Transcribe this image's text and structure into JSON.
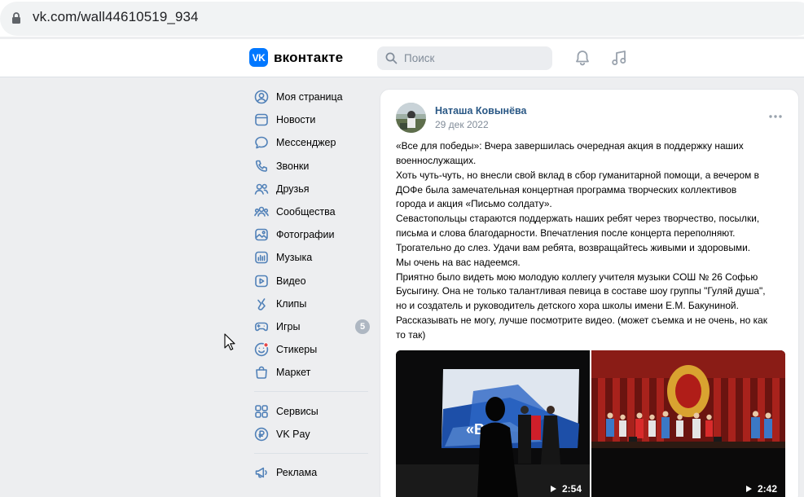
{
  "browser": {
    "url": "vk.com/wall44610519_934"
  },
  "header": {
    "logo_mark": "VK",
    "logo_text": "вконтакте",
    "search_placeholder": "Поиск"
  },
  "sidebar": {
    "group1": [
      {
        "label": "Моя страница",
        "icon": "user-icon"
      },
      {
        "label": "Новости",
        "icon": "news-icon"
      },
      {
        "label": "Мессенджер",
        "icon": "chat-icon"
      },
      {
        "label": "Звонки",
        "icon": "phone-icon"
      },
      {
        "label": "Друзья",
        "icon": "friends-icon"
      },
      {
        "label": "Сообщества",
        "icon": "communities-icon"
      },
      {
        "label": "Фотографии",
        "icon": "photos-icon"
      },
      {
        "label": "Музыка",
        "icon": "music-icon"
      },
      {
        "label": "Видео",
        "icon": "video-icon"
      },
      {
        "label": "Клипы",
        "icon": "clips-icon"
      },
      {
        "label": "Игры",
        "icon": "games-icon",
        "badge": "5"
      },
      {
        "label": "Стикеры",
        "icon": "stickers-icon"
      },
      {
        "label": "Маркет",
        "icon": "market-icon"
      }
    ],
    "group2": [
      {
        "label": "Сервисы",
        "icon": "services-icon"
      },
      {
        "label": "VK Pay",
        "icon": "vkpay-icon"
      }
    ],
    "group3": [
      {
        "label": "Реклама",
        "icon": "ads-icon"
      }
    ]
  },
  "post": {
    "author": "Наташа Ковынёва",
    "date": "29 дек 2022",
    "lines": [
      "«Все для победы»: Вчера завершилась очередная акция в поддержку наших",
      "военнослужащих.",
      "Хоть чуть-чуть, но внесли свой вклад в сбор гуманитарной помощи, а вечером в",
      "ДОФе была замечательная концертная программа творческих коллективов",
      "города и акция «Письмо солдату».",
      "Севастопольцы стараются поддержать наших ребят через творчество, посылки,",
      "письма и слова благодарности. Впечатления после концерта переполняют.",
      "Трогательно до слез. Удачи вам ребята, возвращайтесь живыми и здоровыми.",
      "Мы очень на вас надеемся.",
      "Приятно было видеть мою молодую коллегу учителя музыки СОШ № 26 Софью",
      "Бусыгину. Она не только талантливая певица в составе шоу группы \"Гуляй душа\",",
      "но и создатель и руководитель детского хора школы имени Е.М. Бакуниной.",
      "Рассказывать не могу, лучше посмотрите видео. (может съемка и не очень, но как",
      "то так)"
    ],
    "videos": [
      {
        "duration": "2:54",
        "screen_text": "«ВС"
      },
      {
        "duration": "2:42"
      }
    ]
  },
  "colors": {
    "accent": "#0077ff",
    "link": "#2a5885",
    "page_bg": "#edeef0",
    "badge": "#aeb7c2"
  }
}
